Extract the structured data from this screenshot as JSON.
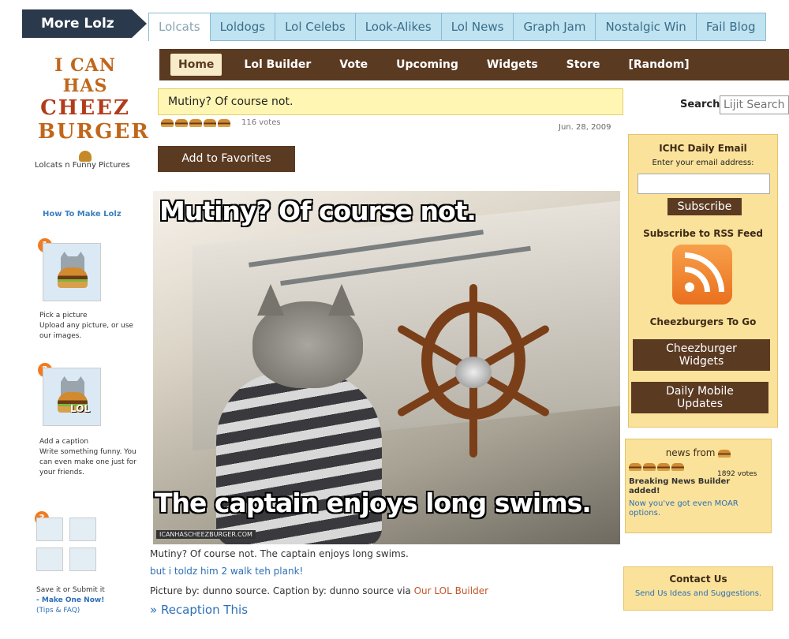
{
  "topbar": {
    "more_lolz": "More Lolz",
    "tabs": [
      "Lolcats",
      "Loldogs",
      "Lol Celebs",
      "Look-Alikes",
      "Lol News",
      "Graph Jam",
      "Nostalgic Win",
      "Fail Blog"
    ]
  },
  "logo": {
    "line1": "I CAN HAS",
    "line2": "CHEEZ",
    "line3": "BURGER"
  },
  "sidebar": {
    "tagline": "Lolcats n Funny Pictures",
    "howto": "How To Make Lolz",
    "steps": [
      {
        "num": "1",
        "title": "Pick a picture",
        "text": "Upload any picture, or use our images."
      },
      {
        "num": "2",
        "title": "Add a caption",
        "text": "Write something funny. You can even make one just for your friends."
      },
      {
        "num": "3",
        "title": "Save it or Submit it",
        "link": "- Make One Now!",
        "tips": "(Tips & FAQ)"
      }
    ],
    "lol_badge": "LOL"
  },
  "nav": {
    "items": [
      "Home",
      "Lol Builder",
      "Vote",
      "Upcoming",
      "Widgets",
      "Store",
      "[Random]"
    ]
  },
  "post": {
    "title": "Mutiny? Of course not.",
    "votes": "116 votes",
    "date": "Jun. 28, 2009",
    "favorites": "Add to Favorites",
    "meme_top": "Mutiny? Of course not.",
    "meme_bottom": "The captain enjoys long swims.",
    "watermark": "ICANHASCHEEZBURGER.COM",
    "caption": "Mutiny? Of course not. The captain enjoys long swims.",
    "comment": "but i toldz him 2 walk teh plank!",
    "credit_prefix": "Picture by: dunno source. Caption by: dunno source via",
    "credit_link": "Our LOL Builder",
    "recaption": "» Recaption This"
  },
  "right": {
    "search_label": "Search",
    "search_placeholder": "Lijit Search",
    "email_title": "ICHC Daily Email",
    "email_prompt": "Enter your email address:",
    "subscribe": "Subscribe",
    "rss_title": "Subscribe to RSS Feed",
    "to_go_title": "Cheezburgers To Go",
    "widgets_btn": "Cheezburger Widgets",
    "mobile_btn": "Daily Mobile Updates",
    "news_title": "news from",
    "news_votes": "1892 votes",
    "news_headline": "Breaking News Builder added!",
    "news_link": "Now you've got even MOAR options.",
    "contact_title": "Contact Us",
    "contact_link": "Send Us Ideas and Suggestions."
  },
  "colors": {
    "brown": "#5b3a22",
    "tab_blue": "#bfe3f0",
    "yellow_box": "#fbe29a",
    "link_blue": "#2c6fb7"
  }
}
